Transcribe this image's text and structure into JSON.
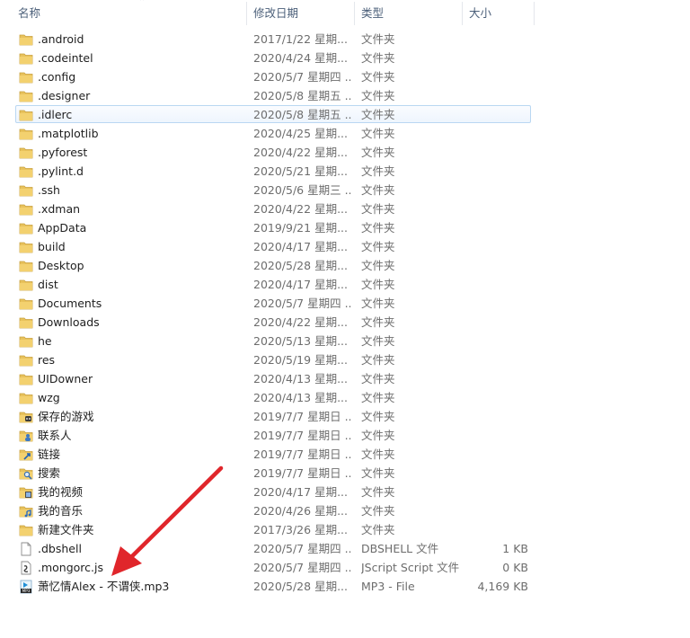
{
  "columns": {
    "name": "名称",
    "date": "修改日期",
    "type": "类型",
    "size": "大小"
  },
  "rows": [
    {
      "name": ".android",
      "date": "2017/1/22 星期...",
      "type": "文件夹",
      "size": "",
      "icon": "folder-icon"
    },
    {
      "name": ".codeintel",
      "date": "2020/4/24 星期...",
      "type": "文件夹",
      "size": "",
      "icon": "folder-icon"
    },
    {
      "name": ".config",
      "date": "2020/5/7 星期四 ...",
      "type": "文件夹",
      "size": "",
      "icon": "folder-icon"
    },
    {
      "name": ".designer",
      "date": "2020/5/8 星期五 ...",
      "type": "文件夹",
      "size": "",
      "icon": "folder-icon"
    },
    {
      "name": ".idlerc",
      "date": "2020/5/8 星期五 ...",
      "type": "文件夹",
      "size": "",
      "icon": "folder-icon",
      "selected": true
    },
    {
      "name": ".matplotlib",
      "date": "2020/4/25 星期...",
      "type": "文件夹",
      "size": "",
      "icon": "folder-icon"
    },
    {
      "name": ".pyforest",
      "date": "2020/4/22 星期...",
      "type": "文件夹",
      "size": "",
      "icon": "folder-icon"
    },
    {
      "name": ".pylint.d",
      "date": "2020/5/21 星期...",
      "type": "文件夹",
      "size": "",
      "icon": "folder-icon"
    },
    {
      "name": ".ssh",
      "date": "2020/5/6 星期三 ...",
      "type": "文件夹",
      "size": "",
      "icon": "folder-icon"
    },
    {
      "name": ".xdman",
      "date": "2020/4/22 星期...",
      "type": "文件夹",
      "size": "",
      "icon": "folder-icon"
    },
    {
      "name": "AppData",
      "date": "2019/9/21 星期...",
      "type": "文件夹",
      "size": "",
      "icon": "folder-icon"
    },
    {
      "name": "build",
      "date": "2020/4/17 星期...",
      "type": "文件夹",
      "size": "",
      "icon": "folder-icon"
    },
    {
      "name": "Desktop",
      "date": "2020/5/28 星期...",
      "type": "文件夹",
      "size": "",
      "icon": "folder-icon"
    },
    {
      "name": "dist",
      "date": "2020/4/17 星期...",
      "type": "文件夹",
      "size": "",
      "icon": "folder-icon"
    },
    {
      "name": "Documents",
      "date": "2020/5/7 星期四 ...",
      "type": "文件夹",
      "size": "",
      "icon": "folder-icon"
    },
    {
      "name": "Downloads",
      "date": "2020/4/22 星期...",
      "type": "文件夹",
      "size": "",
      "icon": "folder-icon"
    },
    {
      "name": "he",
      "date": "2020/5/13 星期...",
      "type": "文件夹",
      "size": "",
      "icon": "folder-icon"
    },
    {
      "name": "res",
      "date": "2020/5/19 星期...",
      "type": "文件夹",
      "size": "",
      "icon": "folder-icon"
    },
    {
      "name": "UIDowner",
      "date": "2020/4/13 星期...",
      "type": "文件夹",
      "size": "",
      "icon": "folder-icon"
    },
    {
      "name": "wzg",
      "date": "2020/4/13 星期...",
      "type": "文件夹",
      "size": "",
      "icon": "folder-icon"
    },
    {
      "name": "保存的游戏",
      "date": "2019/7/7 星期日 ...",
      "type": "文件夹",
      "size": "",
      "icon": "saved-games-icon"
    },
    {
      "name": "联系人",
      "date": "2019/7/7 星期日 ...",
      "type": "文件夹",
      "size": "",
      "icon": "contacts-icon"
    },
    {
      "name": "链接",
      "date": "2019/7/7 星期日 ...",
      "type": "文件夹",
      "size": "",
      "icon": "links-icon"
    },
    {
      "name": "搜索",
      "date": "2019/7/7 星期日 ...",
      "type": "文件夹",
      "size": "",
      "icon": "search-folder-icon"
    },
    {
      "name": "我的视频",
      "date": "2020/4/17 星期...",
      "type": "文件夹",
      "size": "",
      "icon": "videos-folder-icon"
    },
    {
      "name": "我的音乐",
      "date": "2020/4/26 星期...",
      "type": "文件夹",
      "size": "",
      "icon": "music-folder-icon"
    },
    {
      "name": "新建文件夹",
      "date": "2017/3/26 星期...",
      "type": "文件夹",
      "size": "",
      "icon": "folder-icon"
    },
    {
      "name": ".dbshell",
      "date": "2020/5/7 星期四 ...",
      "type": "DBSHELL 文件",
      "size": "1 KB",
      "icon": "file-icon"
    },
    {
      "name": ".mongorc.js",
      "date": "2020/5/7 星期四 ...",
      "type": "JScript Script 文件",
      "size": "0 KB",
      "icon": "script-file-icon"
    },
    {
      "name": "萧忆情Alex - 不谓侠.mp3",
      "date": "2020/5/28 星期...",
      "type": "MP3 - File",
      "size": "4,169 KB",
      "icon": "mp3-file-icon"
    }
  ],
  "colors": {
    "header_text": "#4c607a",
    "selection_border": "#b9d7f2",
    "arrow": "#e0262b",
    "folder": "#e8c25c"
  }
}
